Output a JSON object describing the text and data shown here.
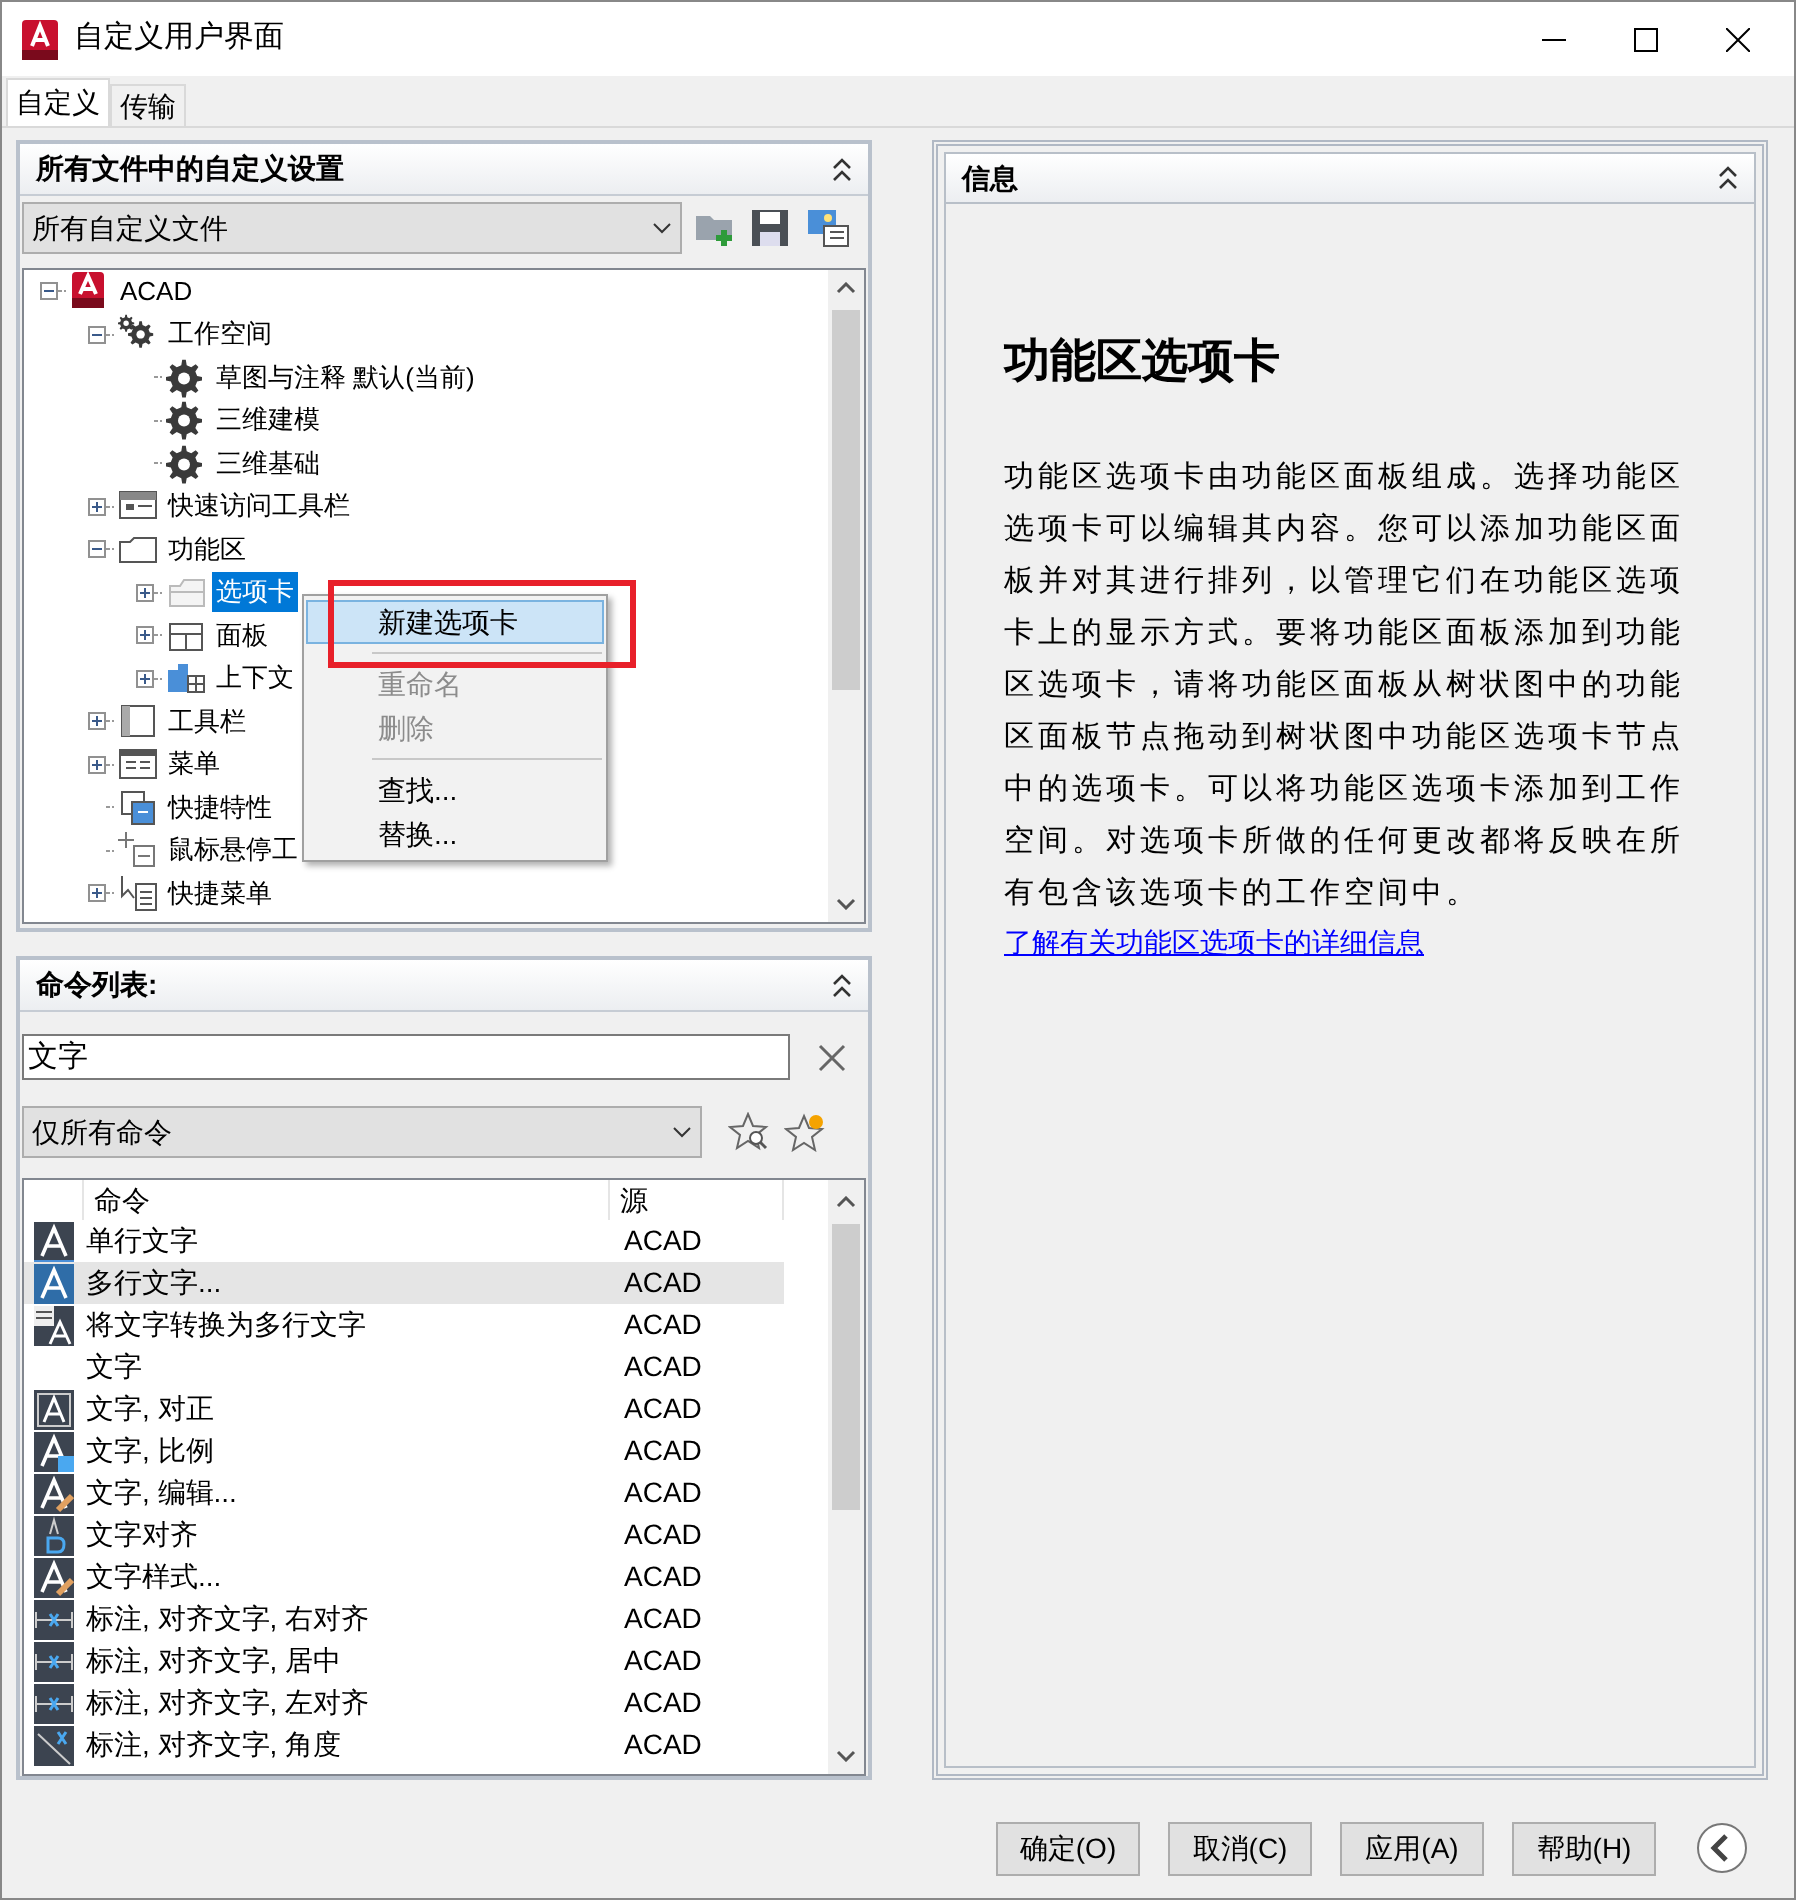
{
  "window": {
    "title": "自定义用户界面"
  },
  "tabs": [
    {
      "label": "自定义",
      "selected": true
    },
    {
      "label": "传输",
      "selected": false
    }
  ],
  "customizations": {
    "title": "所有文件中的自定义设置",
    "file_select": "所有自定义文件",
    "tree": [
      {
        "label": "ACAD",
        "kind": "acad",
        "expanded": true,
        "selected": false,
        "children": [
          {
            "label": "工作空间",
            "kind": "gears",
            "expanded": true,
            "selected": false,
            "children": [
              {
                "label": "草图与注释 默认(当前)",
                "kind": "gear",
                "selected": false
              },
              {
                "label": "三维建模",
                "kind": "gear",
                "selected": false
              },
              {
                "label": "三维基础",
                "kind": "gear",
                "selected": false
              }
            ]
          },
          {
            "label": "快速访问工具栏",
            "kind": "qat",
            "expanded": false,
            "selected": false
          },
          {
            "label": "功能区",
            "kind": "ribbon",
            "expanded": true,
            "selected": false,
            "children": [
              {
                "label": "选项卡",
                "kind": "tabs",
                "expanded": false,
                "selected": true
              },
              {
                "label": "面板",
                "kind": "panels",
                "expanded": false,
                "selected": false
              },
              {
                "label": "上下文",
                "kind": "context",
                "expanded": false,
                "selected": false
              }
            ]
          },
          {
            "label": "工具栏",
            "kind": "toolbar",
            "expanded": false,
            "selected": false
          },
          {
            "label": "菜单",
            "kind": "menu",
            "expanded": false,
            "selected": false
          },
          {
            "label": "快捷特性",
            "kind": "props",
            "selected": false
          },
          {
            "label": "鼠标悬停工",
            "kind": "rollover",
            "selected": false
          },
          {
            "label": "快捷菜单",
            "kind": "shortcut",
            "expanded": false,
            "selected": false
          }
        ]
      }
    ],
    "context_menu": [
      {
        "kind": "item",
        "label": "新建选项卡",
        "disabled": false,
        "highlighted": true
      },
      {
        "kind": "separator"
      },
      {
        "kind": "item",
        "label": "重命名",
        "disabled": true,
        "highlighted": false
      },
      {
        "kind": "item",
        "label": "删除",
        "disabled": true,
        "highlighted": false
      },
      {
        "kind": "separator"
      },
      {
        "kind": "item",
        "label": "查找...",
        "disabled": false,
        "highlighted": false
      },
      {
        "kind": "item",
        "label": "替换...",
        "disabled": false,
        "highlighted": false
      }
    ]
  },
  "command_list": {
    "title": "命令列表:",
    "search": "文字",
    "filter": "仅所有命令",
    "columns": [
      "命令",
      "源"
    ],
    "rows": [
      {
        "kind": "a",
        "command": "单行文字",
        "source": "ACAD",
        "selected": false
      },
      {
        "kind": "a-blue",
        "command": "多行文字...",
        "source": "ACAD",
        "selected": true
      },
      {
        "kind": "convert",
        "command": "将文字转换为多行文字",
        "source": "ACAD",
        "selected": false
      },
      {
        "kind": "plain",
        "command": "文字",
        "source": "ACAD",
        "selected": false
      },
      {
        "kind": "a-box",
        "command": "文字, 对正",
        "source": "ACAD",
        "selected": false
      },
      {
        "kind": "a-scale",
        "command": "文字, 比例",
        "source": "ACAD",
        "selected": false
      },
      {
        "kind": "a-edit",
        "command": "文字, 编辑...",
        "source": "ACAD",
        "selected": false
      },
      {
        "kind": "ab",
        "command": "文字对齐",
        "source": "ACAD",
        "selected": false
      },
      {
        "kind": "a-edit",
        "command": "文字样式...",
        "source": "ACAD",
        "selected": false
      },
      {
        "kind": "dim",
        "command": "标注, 对齐文字, 右对齐",
        "source": "ACAD",
        "selected": false
      },
      {
        "kind": "dim",
        "command": "标注, 对齐文字, 居中",
        "source": "ACAD",
        "selected": false
      },
      {
        "kind": "dim",
        "command": "标注, 对齐文字, 左对齐",
        "source": "ACAD",
        "selected": false
      },
      {
        "kind": "dim-angle",
        "command": "标注, 对齐文字, 角度",
        "source": "ACAD",
        "selected": false
      }
    ]
  },
  "info": {
    "title": "信息",
    "heading": "功能区选项卡",
    "body": "功能区选项卡由功能区面板组成。选择功能区选项卡可以编辑其内容。您可以添加功能区面板并对其进行排列，以管理它们在功能区选项卡上的显示方式。要将功能区面板添加到功能区选项卡，请将功能区面板从树状图中的功能区面板节点拖动到树状图中功能区选项卡节点中的选项卡。可以将功能区选项卡添加到工作空间。对选项卡所做的任何更改都将反映在所有包含该选项卡的工作空间中。",
    "link": "了解有关功能区选项卡的详细信息"
  },
  "buttons": [
    "确定(O)",
    "取消(C)",
    "应用(A)",
    "帮助(H)"
  ]
}
